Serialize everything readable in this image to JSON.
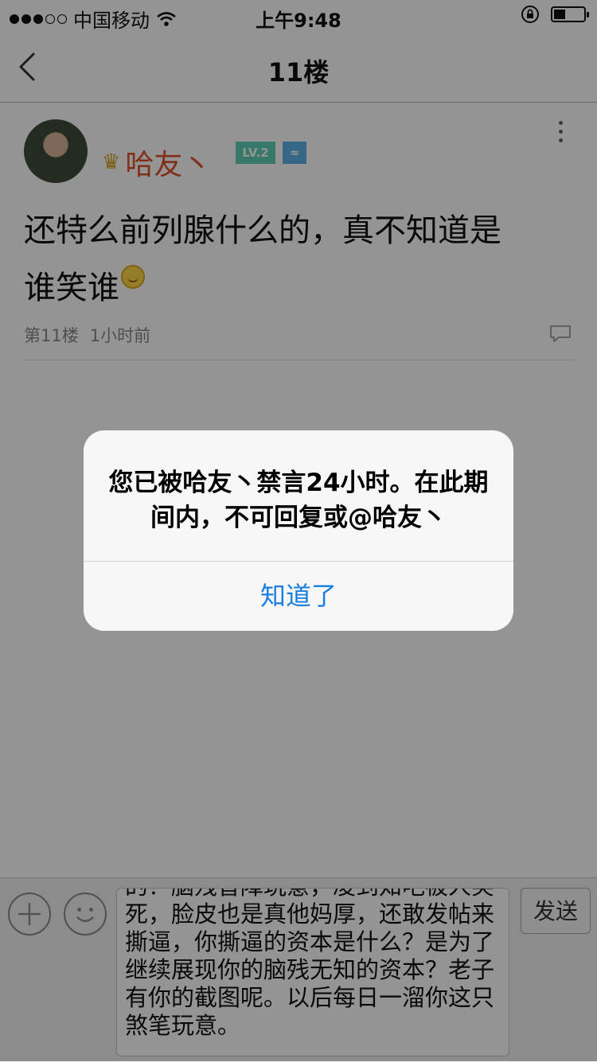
{
  "status_bar": {
    "carrier": "中国移动",
    "time": "上午9:48"
  },
  "nav": {
    "title": "11楼"
  },
  "post": {
    "author": "哈友丶",
    "level_badge": "LV.2",
    "zodiac_badge": "≈",
    "content": "还特么前列腺什么的，真不知道是谁笑谁",
    "floor": "第11楼",
    "time": "1小时前"
  },
  "dialog": {
    "message": "您已被哈友丶禁言24小时。在此期间内，不可回复或@哈友丶",
    "button": "知道了"
  },
  "composer": {
    "draft": "的？脑残智障玩意，凌到知吧被人笑死，脸皮也是真他妈厚，还敢发帖来撕逼，你撕逼的资本是什么？是为了继续展现你的脑残无知的资本？老子有你的截图呢。以后每日一溜你这只煞笔玩意。",
    "send": "发送"
  },
  "colors": {
    "accent": "#1a7ee0",
    "username": "#e0522a",
    "overlay": "rgba(0,0,0,0.42)"
  },
  "icons": [
    "wifi-icon",
    "lock-rotation-icon",
    "battery-icon",
    "back-chevron-icon",
    "crown-icon",
    "more-icon",
    "comment-icon",
    "plus-icon",
    "emoji-icon"
  ]
}
